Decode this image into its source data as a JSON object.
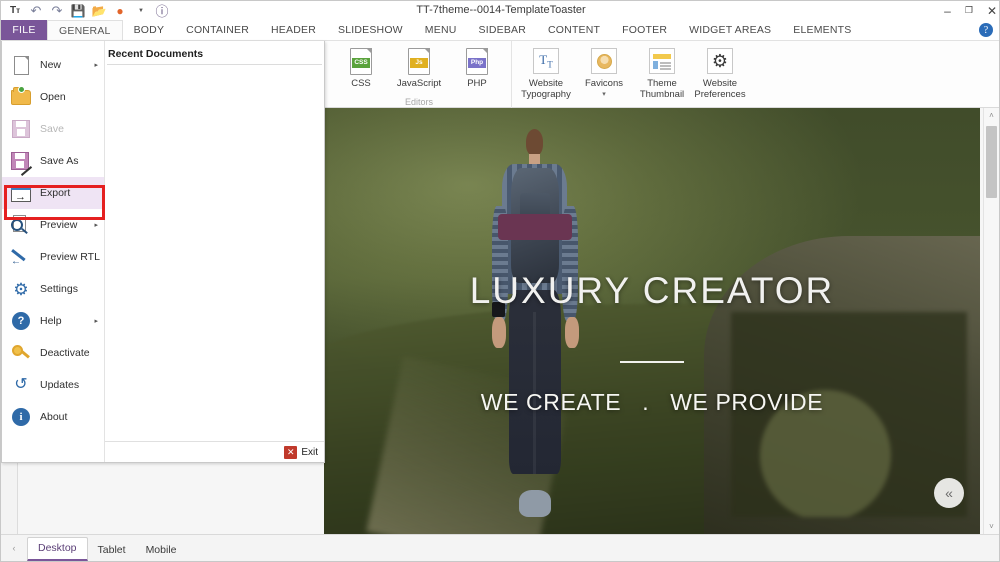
{
  "window": {
    "title": "TT-7theme--0014-TemplateToaster",
    "controls": {
      "minimize": "–",
      "restore": "❐",
      "close": "✕",
      "help": "?"
    }
  },
  "quick_access": [
    {
      "name": "typography-icon",
      "glyph": "Tт"
    },
    {
      "name": "undo-icon",
      "glyph": "↶"
    },
    {
      "name": "redo-icon",
      "glyph": "↷"
    },
    {
      "name": "save-icon",
      "glyph": "▤"
    },
    {
      "name": "open-folder-icon",
      "glyph": "▰"
    },
    {
      "name": "preview-browser-icon",
      "glyph": "●"
    },
    {
      "name": "dropdown-caret-icon",
      "glyph": "▾"
    },
    {
      "name": "wordpress-icon",
      "glyph": "Ⓦ"
    }
  ],
  "ribbon": {
    "file_tab": "FILE",
    "tabs": [
      {
        "label": "GENERAL",
        "active": true
      },
      {
        "label": "BODY",
        "active": false
      },
      {
        "label": "CONTAINER",
        "active": false
      },
      {
        "label": "HEADER",
        "active": false
      },
      {
        "label": "SLIDESHOW",
        "active": false
      },
      {
        "label": "MENU",
        "active": false
      },
      {
        "label": "SIDEBAR",
        "active": false
      },
      {
        "label": "CONTENT",
        "active": false
      },
      {
        "label": "FOOTER",
        "active": false
      },
      {
        "label": "WIDGET AREAS",
        "active": false
      },
      {
        "label": "ELEMENTS",
        "active": false
      }
    ],
    "groups": [
      {
        "caption": "Editors",
        "items": [
          {
            "label": "CSS",
            "icon": "css-file-icon"
          },
          {
            "label": "JavaScript",
            "icon": "javascript-file-icon"
          },
          {
            "label": "PHP",
            "icon": "php-file-icon"
          }
        ]
      },
      {
        "caption": "",
        "items": [
          {
            "label": "Website Typography",
            "icon": "typography-icon"
          },
          {
            "label": "Favicons",
            "icon": "favicon-icon",
            "caret": "▾"
          },
          {
            "label": "Theme Thumbnail",
            "icon": "theme-thumbnail-icon"
          },
          {
            "label": "Website Preferences",
            "icon": "gear-icon"
          }
        ]
      }
    ]
  },
  "file_menu": {
    "items": [
      {
        "label": "New",
        "icon": "new-document-icon",
        "submenu": "▸",
        "disabled": false,
        "highlight": false
      },
      {
        "label": "Open",
        "icon": "open-folder-icon",
        "submenu": "",
        "disabled": false,
        "highlight": false
      },
      {
        "label": "Save",
        "icon": "save-disk-icon",
        "submenu": "",
        "disabled": true,
        "highlight": false
      },
      {
        "label": "Save As",
        "icon": "save-as-icon",
        "submenu": "",
        "disabled": false,
        "highlight": false
      },
      {
        "label": "Export",
        "icon": "export-icon",
        "submenu": "",
        "disabled": false,
        "highlight": true
      },
      {
        "label": "Preview",
        "icon": "preview-icon",
        "submenu": "▸",
        "disabled": false,
        "highlight": false
      },
      {
        "label": "Preview RTL",
        "icon": "preview-rtl-icon",
        "submenu": "",
        "disabled": false,
        "highlight": false
      },
      {
        "label": "Settings",
        "icon": "gear-icon",
        "submenu": "",
        "disabled": false,
        "highlight": false
      },
      {
        "label": "Help",
        "icon": "help-icon",
        "submenu": "▸",
        "disabled": false,
        "highlight": false
      },
      {
        "label": "Deactivate",
        "icon": "key-icon",
        "submenu": "",
        "disabled": false,
        "highlight": false
      },
      {
        "label": "Updates",
        "icon": "updates-icon",
        "submenu": "",
        "disabled": false,
        "highlight": false
      },
      {
        "label": "About",
        "icon": "info-icon",
        "submenu": "",
        "disabled": false,
        "highlight": false
      }
    ],
    "recent_documents_title": "Recent Documents",
    "exit_label": "Exit",
    "highlight_color": "#efe4f4",
    "annotation_color": "#e52020"
  },
  "preview": {
    "hero_title": "LUXURY CREATOR",
    "hero_sub_left": "WE CREATE",
    "hero_sub_dot": ".",
    "hero_sub_right": "WE PROVIDE",
    "to_top_icon": "«"
  },
  "device_tabs": [
    {
      "label": "Desktop",
      "active": true
    },
    {
      "label": "Tablet",
      "active": false
    },
    {
      "label": "Mobile",
      "active": false
    }
  ],
  "scrollbar": {
    "up": "˄",
    "down": "˅",
    "left": "‹"
  }
}
